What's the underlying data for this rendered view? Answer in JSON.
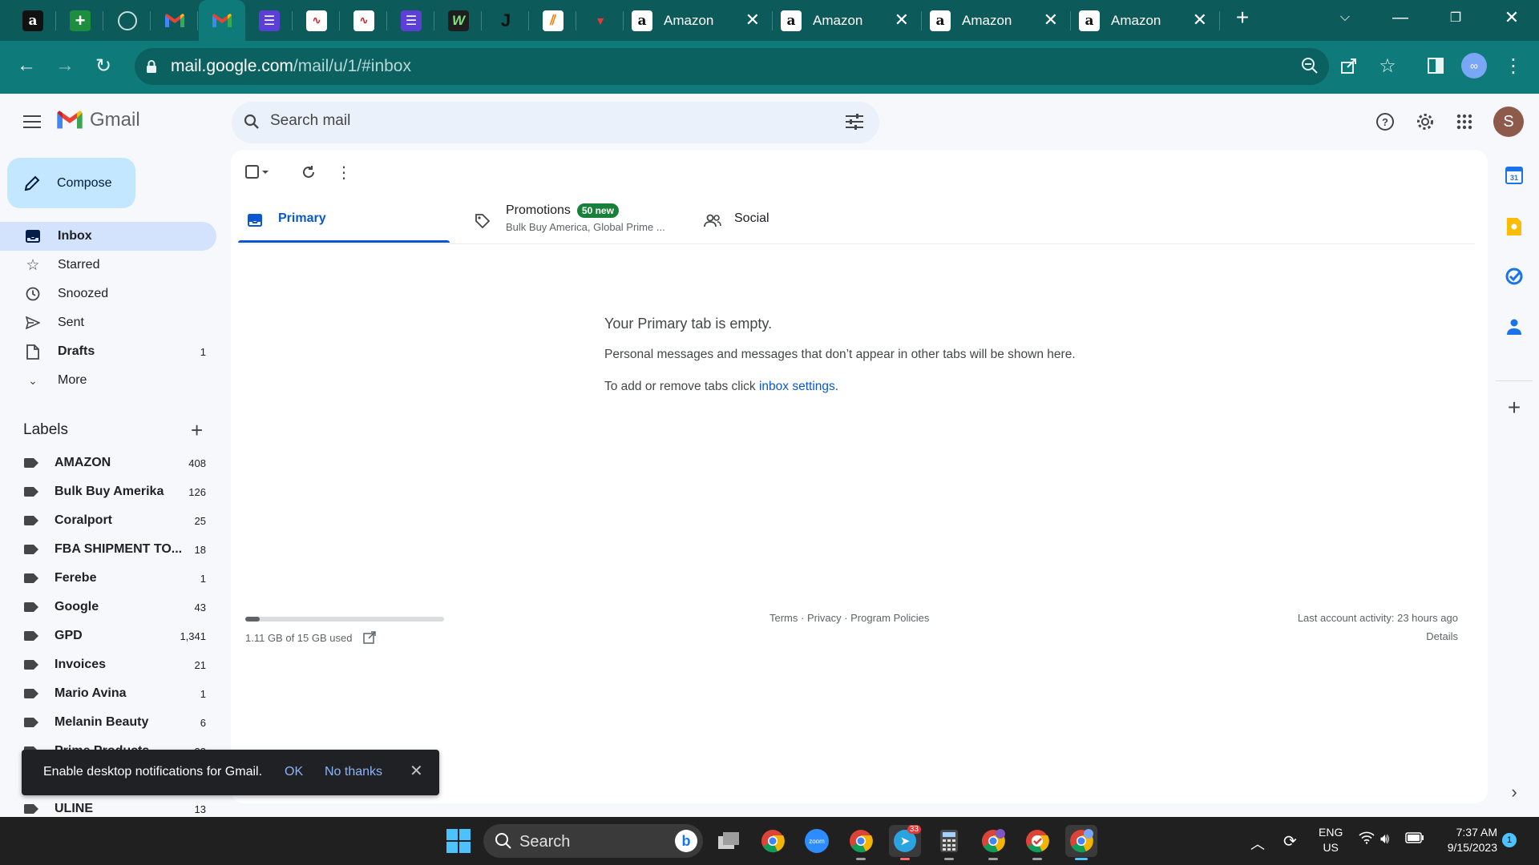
{
  "browser": {
    "url_host": "mail.google.com",
    "url_path": "/mail/u/1/#inbox",
    "tabs": [
      {
        "title": "Amazon"
      },
      {
        "title": "Amazon"
      },
      {
        "title": "Amazon"
      },
      {
        "title": "Amazon"
      }
    ]
  },
  "gmail": {
    "brand": "Gmail",
    "search_placeholder": "Search mail",
    "avatar_initial": "S",
    "compose_label": "Compose",
    "nav": [
      {
        "label": "Inbox",
        "count": ""
      },
      {
        "label": "Starred",
        "count": ""
      },
      {
        "label": "Snoozed",
        "count": ""
      },
      {
        "label": "Sent",
        "count": ""
      },
      {
        "label": "Drafts",
        "count": "1"
      },
      {
        "label": "More",
        "count": ""
      }
    ],
    "labels_title": "Labels",
    "labels": [
      {
        "name": "AMAZON",
        "count": "408"
      },
      {
        "name": "Bulk Buy Amerika",
        "count": "126"
      },
      {
        "name": "Coralport",
        "count": "25"
      },
      {
        "name": "FBA SHIPMENT TO...",
        "count": "18"
      },
      {
        "name": "Ferebe",
        "count": "1"
      },
      {
        "name": "Google",
        "count": "43"
      },
      {
        "name": "GPD",
        "count": "1,341"
      },
      {
        "name": "Invoices",
        "count": "21"
      },
      {
        "name": "Mario Avina",
        "count": "1"
      },
      {
        "name": "Melanin Beauty",
        "count": "6"
      },
      {
        "name": "Prime Products",
        "count": "33"
      },
      {
        "name": "ULINE",
        "count": "13"
      }
    ],
    "tabs": {
      "primary": "Primary",
      "promotions": "Promotions",
      "promotions_badge": "50 new",
      "promotions_snippet": "Bulk Buy America, Global Prime ...",
      "social": "Social"
    },
    "empty": {
      "title": "Your Primary tab is empty.",
      "desc": "Personal messages and messages that don’t appear in other tabs will be shown here.",
      "hint_prefix": "To add or remove tabs click ",
      "hint_link": "inbox settings",
      "hint_suffix": "."
    },
    "storage": {
      "text": "1.11 GB of 15 GB used",
      "fraction": 0.074
    },
    "footer": {
      "terms": "Terms",
      "privacy": "Privacy",
      "policies": "Program Policies",
      "activity": "Last account activity: 23 hours ago",
      "details": "Details"
    },
    "snackbar": {
      "message": "Enable desktop notifications for Gmail.",
      "ok": "OK",
      "no": "No thanks"
    }
  },
  "taskbar": {
    "search": "Search",
    "telegram_badge": "33",
    "lang": "ENG",
    "region": "US",
    "time": "7:37 AM",
    "date": "9/15/2023",
    "notification_count": "1"
  }
}
